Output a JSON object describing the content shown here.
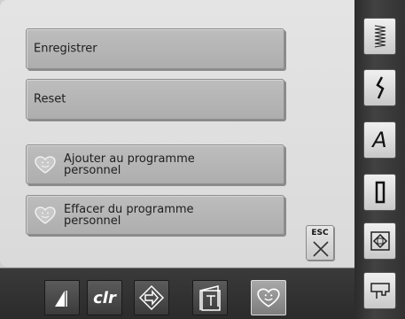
{
  "menu": {
    "save_label": "Enregistrer",
    "reset_label": "Reset",
    "add_to_personal_line1": "Ajouter au programme",
    "add_to_personal_line2": "personnel",
    "delete_from_personal_line1": "Effacer du programme",
    "delete_from_personal_line2": "personnel"
  },
  "esc_button": {
    "label": "ESC",
    "icon": "close-x-icon"
  },
  "bottom_toolbar": {
    "clr_label": "clr",
    "icons": [
      "tension-icon",
      "clr-icon",
      "navigate-arrow-icon",
      "book-icon",
      "personal-program-heart-icon"
    ]
  },
  "side_toolbar": {
    "a_label": "A",
    "icons": [
      "zigzag-stitch-icon",
      "decorative-stitch-icon",
      "alphabet-icon",
      "buttonhole-icon",
      "quilt-stitch-icon",
      "presser-foot-icon"
    ]
  },
  "colors": {
    "panel": "#dcdcdc",
    "button": "#b4b4b4",
    "dark_bar": "#333333"
  }
}
